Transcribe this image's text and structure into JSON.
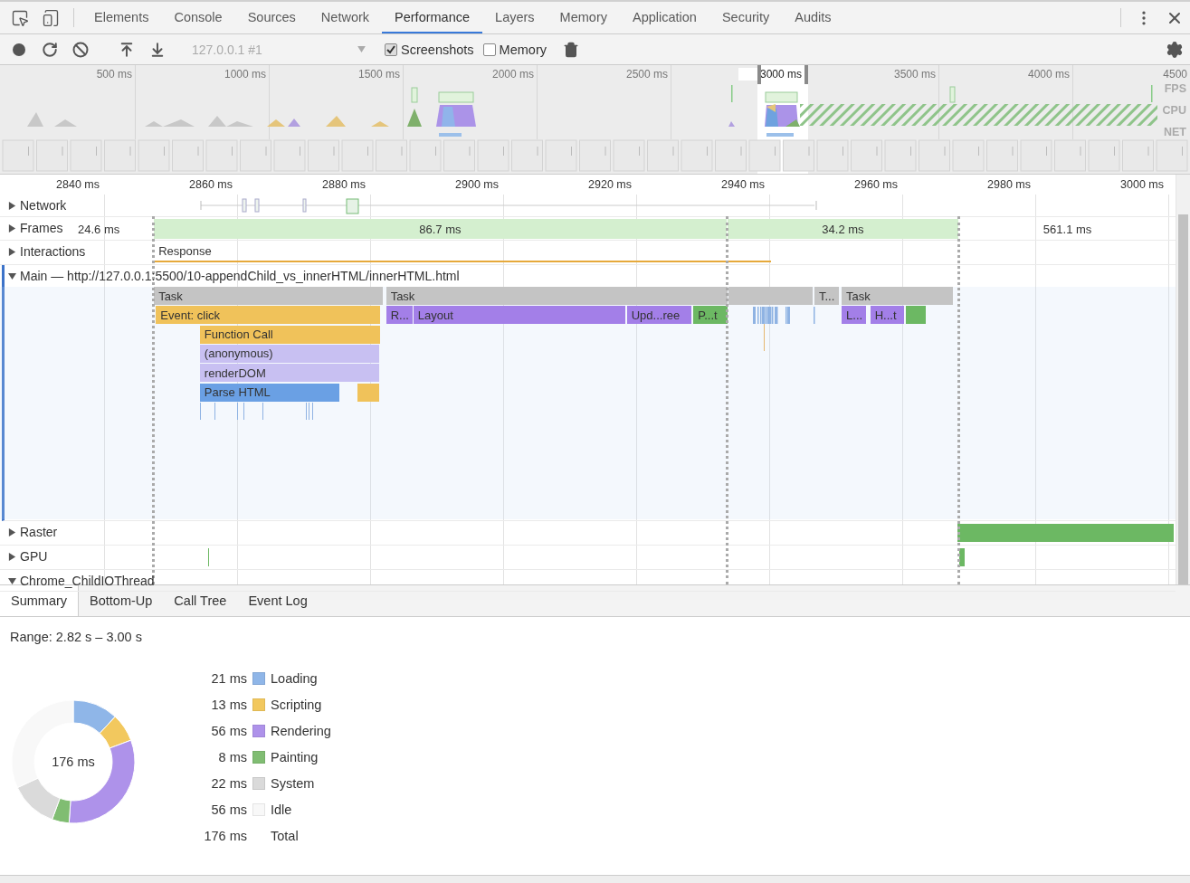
{
  "devtools_tabs": [
    {
      "label": "Elements",
      "selected": false
    },
    {
      "label": "Console",
      "selected": false
    },
    {
      "label": "Sources",
      "selected": false
    },
    {
      "label": "Network",
      "selected": false
    },
    {
      "label": "Performance",
      "selected": true
    },
    {
      "label": "Layers",
      "selected": false
    },
    {
      "label": "Memory",
      "selected": false
    },
    {
      "label": "Application",
      "selected": false
    },
    {
      "label": "Security",
      "selected": false
    },
    {
      "label": "Audits",
      "selected": false
    }
  ],
  "toolbar": {
    "target": "127.0.0.1 #1",
    "checkboxes": [
      {
        "label": "Screenshots",
        "checked": true
      },
      {
        "label": "Memory",
        "checked": false
      }
    ]
  },
  "overview": {
    "ticks": [
      {
        "label": "500 ms",
        "selected": false
      },
      {
        "label": "1000 ms",
        "selected": false
      },
      {
        "label": "1500 ms",
        "selected": false
      },
      {
        "label": "2000 ms",
        "selected": false
      },
      {
        "label": "2500 ms",
        "selected": false
      },
      {
        "label": "3000 ms",
        "selected": true
      },
      {
        "label": "3500 ms",
        "selected": false
      },
      {
        "label": "4000 ms",
        "selected": false
      },
      {
        "label": "4500",
        "selected": false
      }
    ],
    "lanes": [
      "FPS",
      "CPU",
      "NET"
    ]
  },
  "ruler": [
    "2840 ms",
    "2860 ms",
    "2880 ms",
    "2900 ms",
    "2920 ms",
    "2940 ms",
    "2960 ms",
    "2980 ms",
    "3000 ms"
  ],
  "tracks": [
    {
      "kind": "network",
      "label": "Network",
      "expanded": false
    },
    {
      "kind": "frames",
      "label": "Frames",
      "expanded": false,
      "frames": [
        {
          "duration": "24.6 ms",
          "idle": true
        },
        {
          "duration": "86.7 ms",
          "idle": false
        },
        {
          "duration": "34.2 ms",
          "idle": false
        },
        {
          "duration": "561.1 ms",
          "idle": true
        }
      ]
    },
    {
      "kind": "interactions",
      "label": "Interactions",
      "expanded": false,
      "events": [
        {
          "label": "Response"
        }
      ]
    },
    {
      "kind": "main",
      "label": "Main — http://127.0.0.1:5500/10-appendChild_vs_innerHTML/innerHTML.html",
      "expanded": true,
      "events": [
        {
          "kind": "task",
          "label": "Task"
        },
        {
          "kind": "task",
          "label": "Task"
        },
        {
          "kind": "task"
        },
        {
          "kind": "task",
          "label": "T..."
        },
        {
          "kind": "task",
          "label": "Task"
        },
        {
          "kind": "scripting",
          "label": "Event: click"
        },
        {
          "kind": "rendering",
          "label": "R..."
        },
        {
          "kind": "rendering",
          "label": "Layout"
        },
        {
          "kind": "rendering",
          "label": "Upd...ree"
        },
        {
          "kind": "painting",
          "label": "P...t"
        },
        {
          "kind": "rendering",
          "label": "L..."
        },
        {
          "kind": "rendering",
          "label": "H...t"
        },
        {
          "kind": "painting"
        },
        {
          "kind": "scripting",
          "label": "Function Call"
        },
        {
          "kind": "function",
          "label": "(anonymous)"
        },
        {
          "kind": "function",
          "label": "renderDOM"
        },
        {
          "kind": "loading",
          "label": "Parse HTML"
        },
        {
          "kind": "scripting"
        }
      ]
    },
    {
      "kind": "raster",
      "label": "Raster",
      "expanded": false,
      "events": [
        {
          "kind": "painting"
        }
      ]
    },
    {
      "kind": "gpu",
      "label": "GPU",
      "expanded": false,
      "events": [
        {
          "kind": "painting"
        },
        {
          "kind": "painting"
        }
      ]
    },
    {
      "kind": "thread",
      "label": "Chrome_ChildIOThread",
      "expanded": true
    }
  ],
  "details_tabs": [
    {
      "label": "Summary",
      "selected": true
    },
    {
      "label": "Bottom-Up",
      "selected": false
    },
    {
      "label": "Call Tree",
      "selected": false
    },
    {
      "label": "Event Log",
      "selected": false
    }
  ],
  "summary": {
    "range": "Range: 2.82 s – 3.00 s",
    "center_label": "176 ms",
    "categories": [
      {
        "value": "21 ms",
        "label": "Loading",
        "color": "#8fb6e8"
      },
      {
        "value": "13 ms",
        "label": "Scripting",
        "color": "#f2c85e"
      },
      {
        "value": "56 ms",
        "label": "Rendering",
        "color": "#ae92ea"
      },
      {
        "value": "8 ms",
        "label": "Painting",
        "color": "#80bd72"
      },
      {
        "value": "22 ms",
        "label": "System",
        "color": "#dadada"
      },
      {
        "value": "56 ms",
        "label": "Idle",
        "color": "#f8f8f8"
      }
    ],
    "total": {
      "value": "176 ms",
      "label": "Total"
    },
    "chart_data": {
      "type": "donut",
      "values": [
        11.9,
        7.4,
        31.8,
        4.5,
        12.5,
        31.9
      ]
    }
  }
}
